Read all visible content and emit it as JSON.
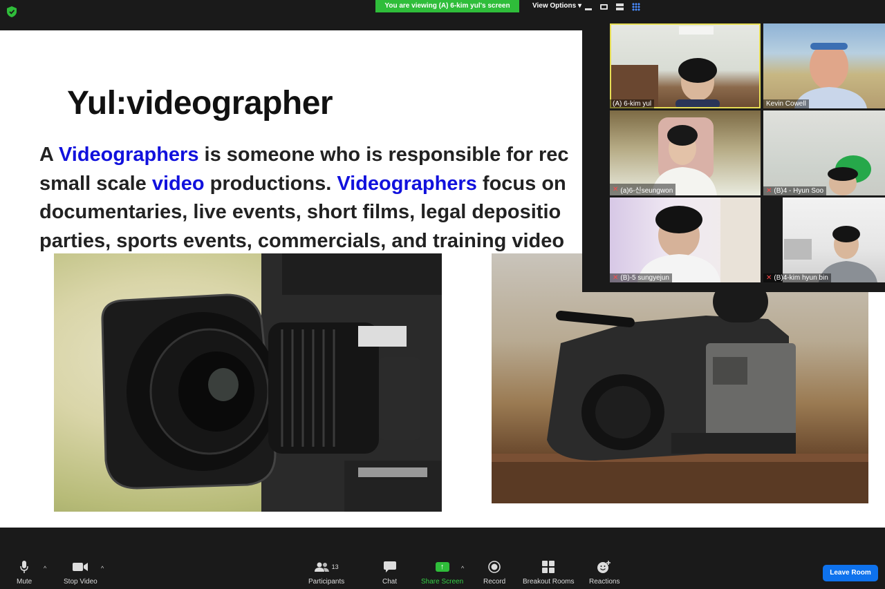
{
  "top_bar": {
    "viewing_banner": "You are viewing (A) 6-kim yul's screen",
    "view_options_label": "View Options"
  },
  "slide": {
    "title": "Yul:videographer",
    "body_lines": [
      [
        {
          "t": "A ",
          "h": false
        },
        {
          "t": "Videographers",
          "h": true
        },
        {
          "t": " is someone who is responsible for rec",
          "h": false
        }
      ],
      [
        {
          "t": "small scale ",
          "h": false
        },
        {
          "t": "video",
          "h": true
        },
        {
          "t": " productions. ",
          "h": false
        },
        {
          "t": "Videographers",
          "h": true
        },
        {
          "t": " focus on",
          "h": false
        }
      ],
      [
        {
          "t": "documentaries, live events, short films, legal depositio",
          "h": false
        }
      ],
      [
        {
          "t": "parties, sports events, commercials, and training video",
          "h": false
        }
      ]
    ]
  },
  "participants": [
    {
      "name": "(A) 6-kim yul",
      "muted": false,
      "active": true
    },
    {
      "name": "Kevin Cowell",
      "muted": false,
      "active": false
    },
    {
      "name": "(a)6-신seungwon",
      "muted": true,
      "active": false
    },
    {
      "name": "(B)4 - Hyun Soo",
      "muted": true,
      "active": false
    },
    {
      "name": "(B)-5 sungyejun",
      "muted": true,
      "active": false
    },
    {
      "name": "(B)4-kim hyun bin",
      "muted": true,
      "active": false
    }
  ],
  "toolbar": {
    "mute_label": "Mute",
    "stop_video_label": "Stop Video",
    "participants_label": "Participants",
    "participants_count": "13",
    "chat_label": "Chat",
    "share_screen_label": "Share Screen",
    "record_label": "Record",
    "breakout_rooms_label": "Breakout Rooms",
    "reactions_label": "Reactions",
    "leave_label": "Leave Room"
  },
  "colors": {
    "accent_green": "#2fbd3a",
    "leave_blue": "#0e72ed",
    "highlight_blue": "#1111dd",
    "active_outline": "#e6dd54"
  }
}
